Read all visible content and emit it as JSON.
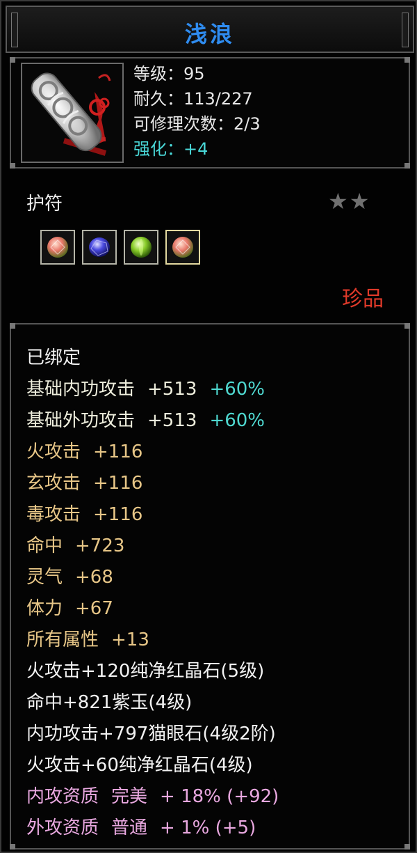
{
  "item": {
    "name": "浅浪",
    "level": "等级：95",
    "durability": "耐久：113/227",
    "repair": "可修理次数：2/3",
    "enhance": "强化：+4",
    "type": "护符",
    "stars": "★★",
    "rarity": "珍品",
    "icon": "amulet-cloud-jade-red-tassel-icon"
  },
  "gems": [
    {
      "icon": "red-crystal-gem-icon"
    },
    {
      "icon": "purple-jade-gem-icon"
    },
    {
      "icon": "cat-eye-gem-icon"
    },
    {
      "icon": "red-crystal-gem-icon"
    }
  ],
  "attributes": {
    "bound": "已绑定",
    "base_internal": {
      "label": "基础内功攻击",
      "value": "+513",
      "bonus": "+60%"
    },
    "base_external": {
      "label": "基础外功攻击",
      "value": "+513",
      "bonus": "+60%"
    },
    "fire": {
      "label": "火攻击",
      "value": "+116"
    },
    "xuan": {
      "label": "玄攻击",
      "value": "+116"
    },
    "poison": {
      "label": "毒攻击",
      "value": "+116"
    },
    "hit": {
      "label": "命中",
      "value": "+723"
    },
    "spirit": {
      "label": "灵气",
      "value": "+68"
    },
    "stamina": {
      "label": "体力",
      "value": "+67"
    },
    "all": {
      "label": "所有属性",
      "value": "+13"
    },
    "gem1": "火攻击+120纯净红晶石(5级)",
    "gem2": "命中+821紫玉(4级)",
    "gem3": "内功攻击+797猫眼石(4级2阶)",
    "gem4": "火攻击+60纯净红晶石(4级)",
    "quality1": {
      "label": "内攻资质",
      "grade": "完美",
      "value": "+ 18% (+92)"
    },
    "quality2": {
      "label": "外攻资质",
      "grade": "普通",
      "value": "+ 1% (+5)"
    }
  },
  "colors": {
    "title": "#2f8cf0",
    "enhance": "#49d8d8",
    "rarity": "#e03a2a",
    "attr_gold": "#e7c687",
    "attr_pink": "#e9a8e0"
  }
}
